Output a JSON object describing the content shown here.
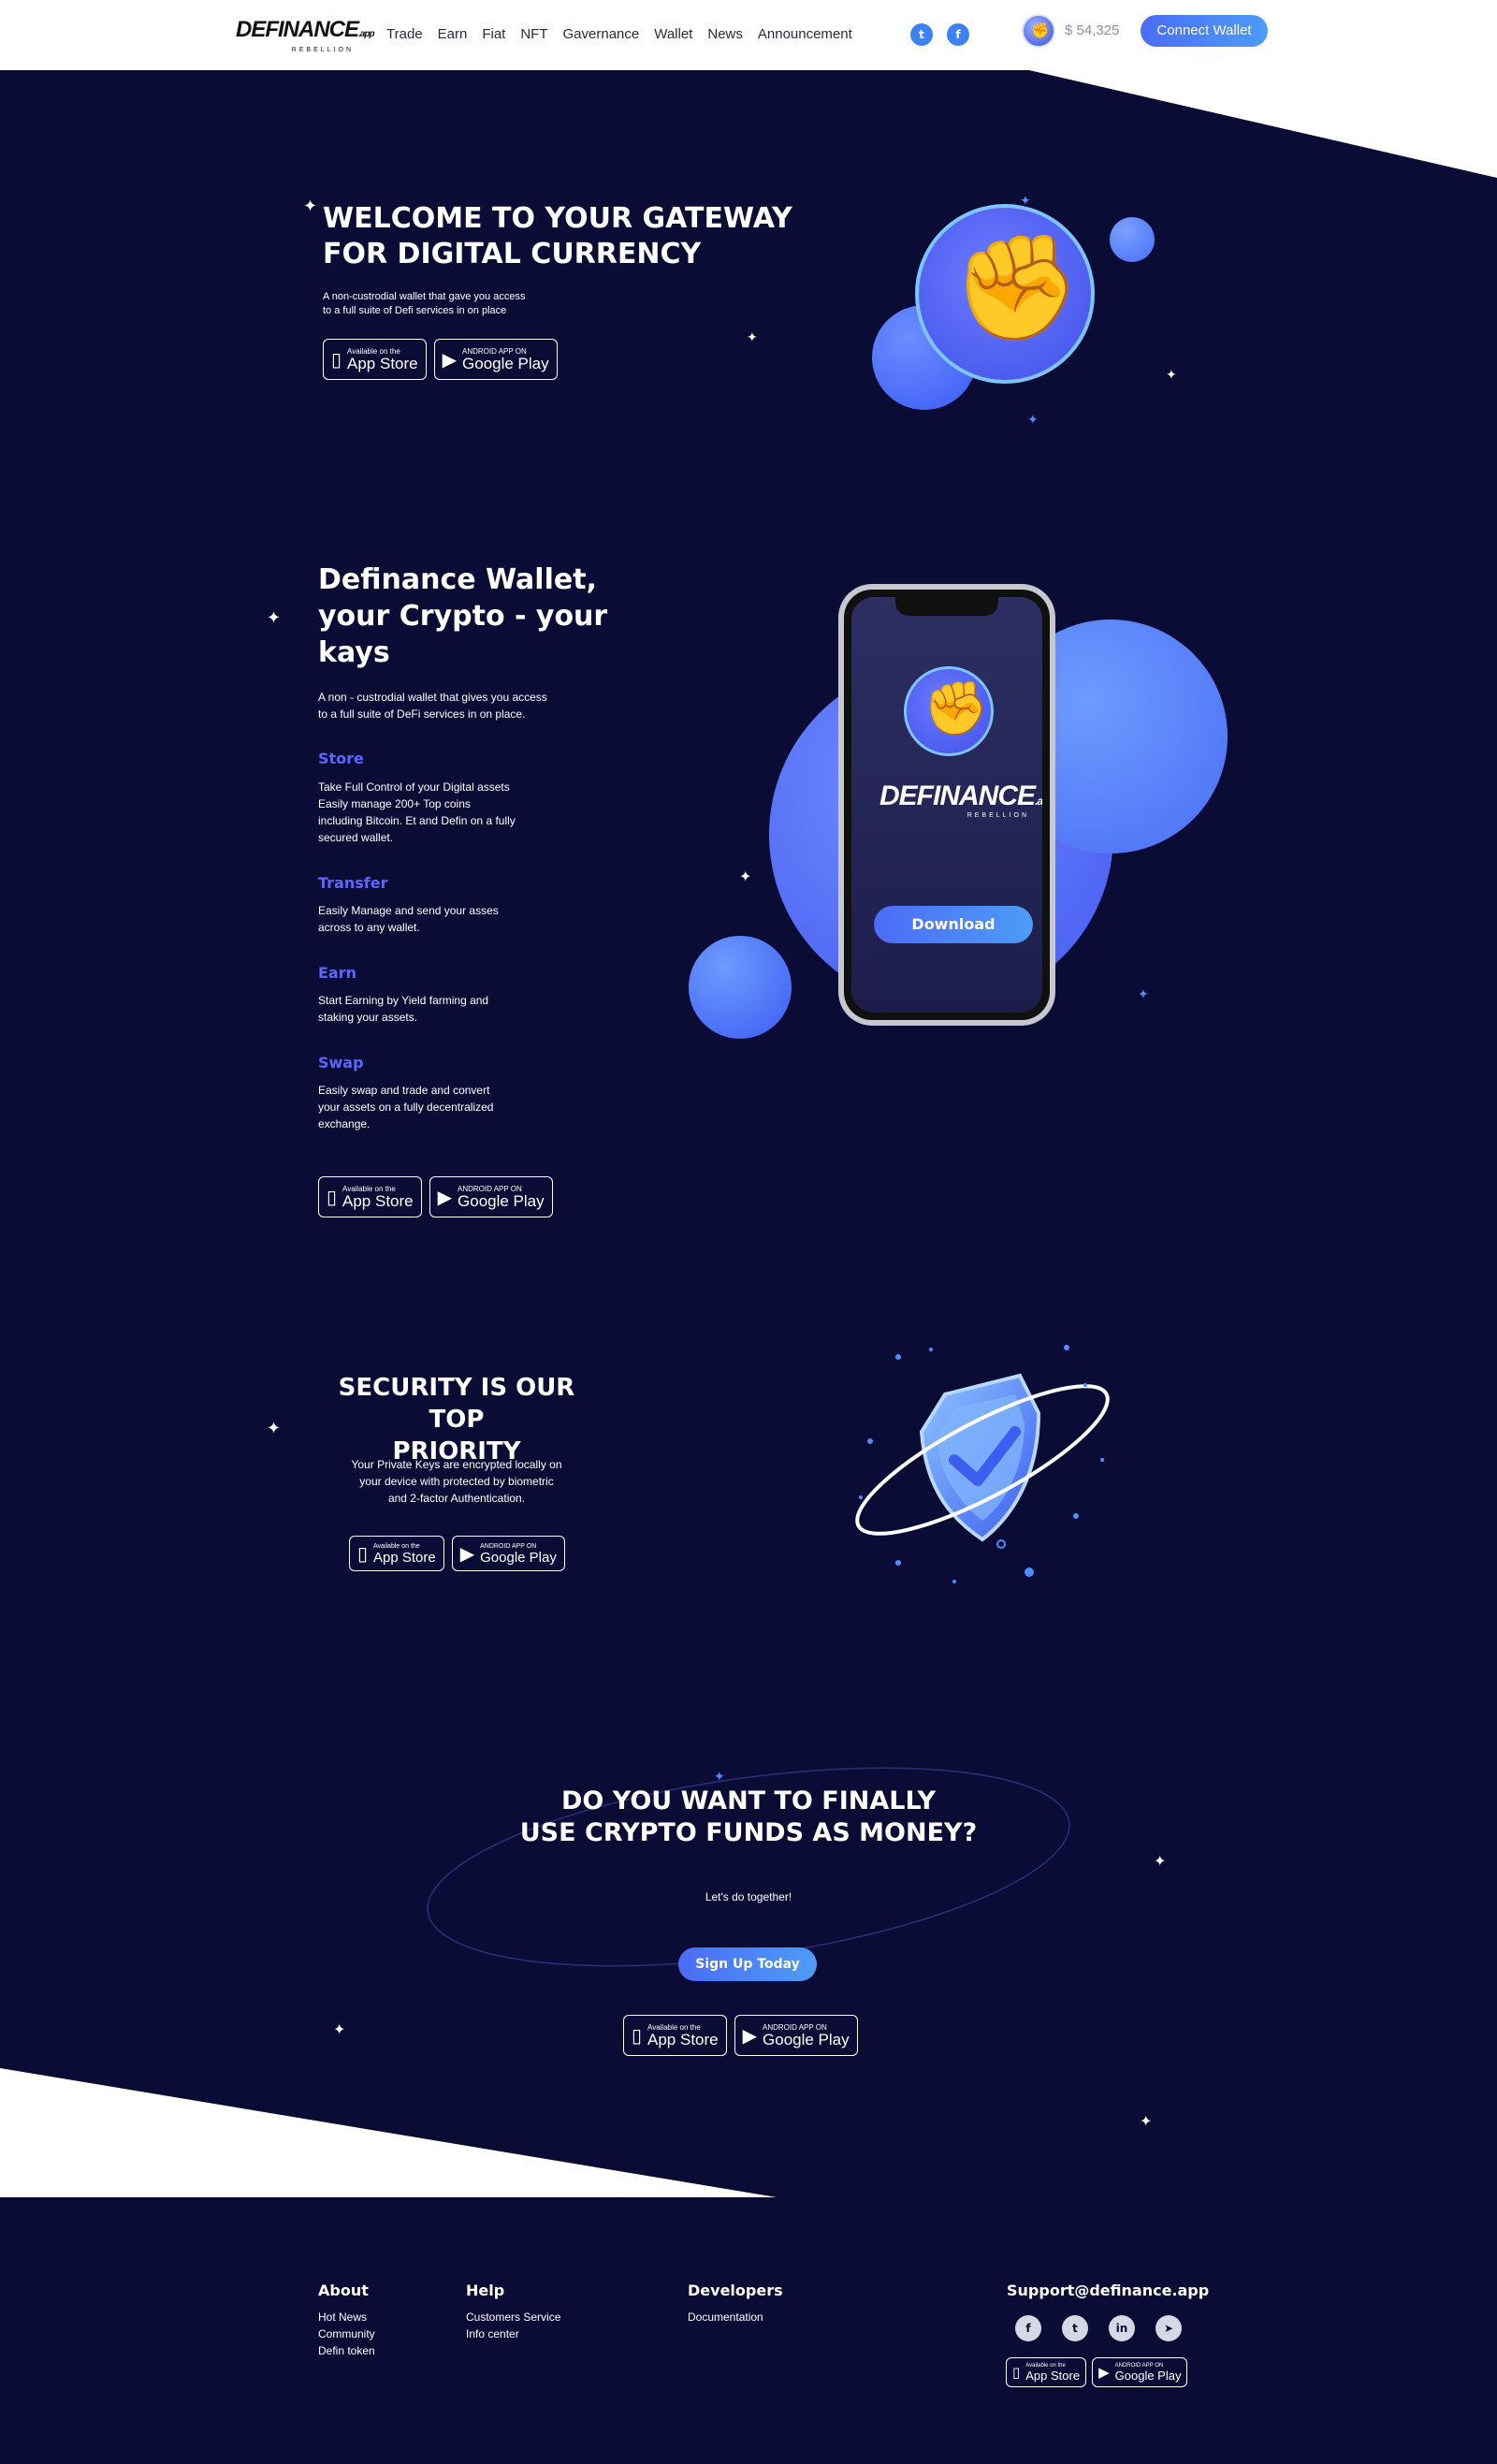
{
  "header": {
    "logo_main": "DEFINANCE",
    "logo_suffix": ".app",
    "logo_sub": "REBELLION",
    "nav": [
      "Trade",
      "Earn",
      "Fiat",
      "NFT",
      "Gavernance",
      "Wallet",
      "News",
      "Announcement"
    ],
    "balance": "$ 54,325",
    "connect_label": "Connect Wallet"
  },
  "hero": {
    "title_line1": "WELCOME TO YOUR GATEWAY",
    "title_line2": "FOR DIGITAL CURRENCY",
    "desc_line1": "A non-custrodial wallet that gave you access",
    "desc_line2": "to a full suite of Defi services in on place"
  },
  "badges": {
    "appstore_small": "Available on the",
    "appstore_big": "App Store",
    "google_small": "ANDROID APP ON",
    "google_big": "Google Play"
  },
  "wallet": {
    "title_line1": "Definance Wallet,",
    "title_line2": "your Crypto - your",
    "title_line3": "kays",
    "desc_line1": "A non - custrodial wallet that gives you access",
    "desc_line2": "to a full suite of DeFi services in on place.",
    "features": [
      {
        "title": "Store",
        "lines": [
          "Take Full Control of your Digital assets",
          "Easily manage 200+ Top coins",
          "including Bitcoin. Et and Defin on a fully",
          "secured wallet."
        ]
      },
      {
        "title": "Transfer",
        "lines": [
          "Easily Manage and send your asses",
          "across to any wallet."
        ]
      },
      {
        "title": "Earn",
        "lines": [
          "Start Earning by Yield farming and",
          "staking your assets."
        ]
      },
      {
        "title": "Swap",
        "lines": [
          "Easily swap and trade and convert",
          "your assets on a fully decentralized",
          "exchange."
        ]
      }
    ],
    "phone_button": "Download"
  },
  "security": {
    "title_line1": "SECURITY IS OUR TOP",
    "title_line2": "PRIORITY",
    "desc_line1": "Your Private Keys are encrypted locally on",
    "desc_line2": "your device with protected by biometric",
    "desc_line3": "and 2-factor Authentication."
  },
  "cta": {
    "title_line1": "DO YOU WANT TO FINALLY",
    "title_line2": "USE CRYPTO FUNDS AS MONEY?",
    "sub": "Let's do together!",
    "button": "Sign Up Today"
  },
  "footer": {
    "about": {
      "title": "About",
      "links": [
        "Hot News",
        "Community",
        "Defin token"
      ]
    },
    "help": {
      "title": "Help",
      "links": [
        "Customers Service",
        "Info center"
      ]
    },
    "developers": {
      "title": "Developers",
      "links": [
        "Documentation"
      ]
    },
    "support_email": "Support@definance.app"
  },
  "colors": {
    "background": "#0b0c35",
    "accent": "#4b6cf7",
    "feature_title": "#5a66ff"
  }
}
